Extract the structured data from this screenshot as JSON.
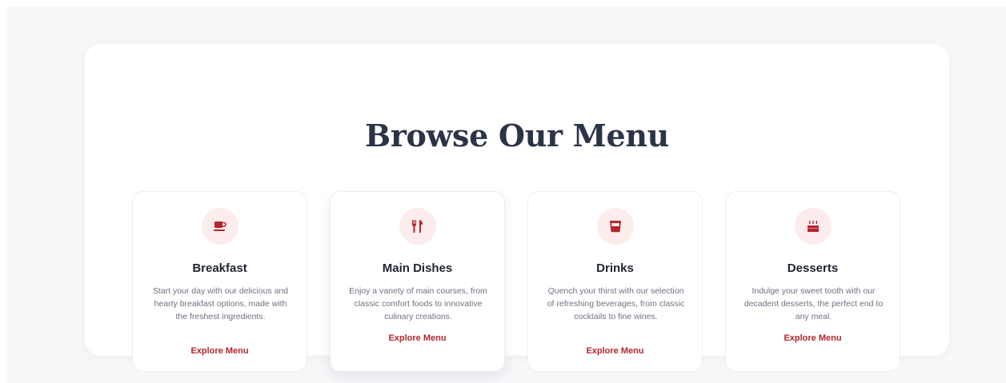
{
  "section": {
    "heading": "Browse Our Menu"
  },
  "theme": {
    "accent": "#b3262d",
    "icon_bg": "#fdecec",
    "heading_color": "#2b3447"
  },
  "cards": [
    {
      "icon": "coffee-cup-icon",
      "title": "Breakfast",
      "description": "Start your day with our delicious and hearty breakfast options, made with the freshest ingredients.",
      "link": "Explore Menu"
    },
    {
      "icon": "utensils-icon",
      "title": "Main Dishes",
      "description": "Enjoy a variety of main courses, from classic comfort foods to innovative culinary creations.",
      "link": "Explore Menu"
    },
    {
      "icon": "glass-icon",
      "title": "Drinks",
      "description": "Quench your thirst with our selection of refreshing beverages, from classic cocktails to fine wines.",
      "link": "Explore Menu"
    },
    {
      "icon": "cake-icon",
      "title": "Desserts",
      "description": "Indulge your sweet tooth with our decadent desserts, the perfect end to any meal.",
      "link": "Explore Menu"
    }
  ]
}
